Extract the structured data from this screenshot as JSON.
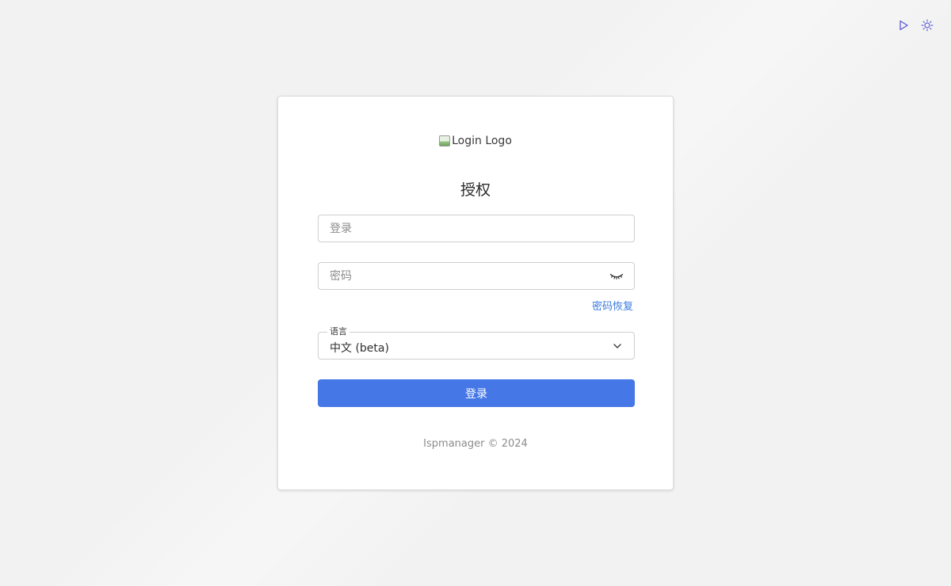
{
  "top_controls": {
    "play_icon": "play-icon",
    "theme_icon": "sun-icon"
  },
  "card": {
    "logo_alt": "Login Logo",
    "title": "授权",
    "login_placeholder": "登录",
    "password_placeholder": "密码",
    "password_toggle_icon": "eye-closed-icon",
    "recover_link": "密码恢复",
    "language": {
      "label": "语言",
      "selected": "中文 (beta)"
    },
    "submit_label": "登录",
    "footer": "Ispmanager © 2024"
  },
  "colors": {
    "background": "#f2f2f2",
    "accent": "#4577e6",
    "link": "#3c7ae0",
    "icon": "#5b5bd6"
  }
}
